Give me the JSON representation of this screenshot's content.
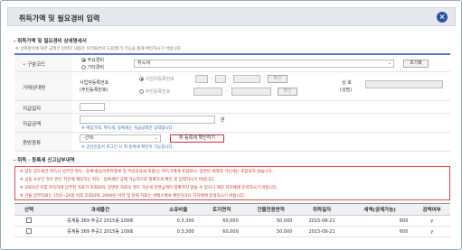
{
  "dialog": {
    "title": "취득가액 및 필요경비 입력",
    "close_label": "×"
  },
  "detail_section": {
    "heading": "- 취득가액 및 필요경비 상세명세서",
    "note": "※ 선택항목에 대한 금액은 입력된 내용은 이전화면의 도움말[?] 기능을 통해 확인하시기 바랍니다.",
    "category": {
      "label": "구분코드",
      "options": [
        "주요경비",
        "기타경비"
      ],
      "selected": "주요경비",
      "select_value": "취득세",
      "reset_label": "초기화"
    },
    "counterpart": {
      "label": "거래상대방",
      "sub_label_1": "사업자등록번호",
      "sub_label_2": "(주민등록번호)",
      "biz_option": "사업자등록번호",
      "resident_option": "주민등록번호",
      "confirm_label": "확인",
      "confirm_label_2": "확인",
      "trade_name_label_1": "상 호",
      "trade_name_label_2": "(성명)"
    },
    "pay_date": {
      "label": "지급일자"
    },
    "pay_amount": {
      "label": "지급금액",
      "unit": "원",
      "hint": "※ 매입가액, 취득세, 등록세는 지급금액만 입력합니다."
    },
    "evidence": {
      "label": "증빙종류",
      "select_value": "-선택-",
      "check_button": "취·등록세 확인하기",
      "hint": "※ 공인인증서 로그인 시 취·등록세 확인이 가능합니다."
    }
  },
  "tax_section": {
    "heading": "- 취득 · 등록세 신고납부내역",
    "notices": [
      "※ 양도 양도물건 취득시 납부한 취득 · 등록세(농어촌특별세 및 지방교육세 포함)는 취득가액에 포함되나, 감면된 세액과 가산세는 포함되지 않습니다.",
      "※ 공동 소유인 경우 본인 지분에 해당하는 취득 · 등록세만 공제 가능하므로 정확하게 확인 후 입력하시기 바랍니다.",
      "※ 2001년 이후 취득하여 납부된 자료가 조회되며, 감면된 자료의 경우 가산세 감면금액이 정확하지 않을 수 있으니 해당 지자체에 문의하시기 바랍니다.",
      "※ 건물 납부자료는 15일~20일 이후 조회되며, 2000년 이전 및 현재 자료는 위택스에서 확인하거나 지자체에 문의하시기 바랍니다."
    ],
    "table": {
      "headers": [
        "선택",
        "과세물건",
        "소유비율",
        "토지면적",
        "건물전용면적",
        "취득일자",
        "세액(공제가능)",
        "감액여부"
      ],
      "rows": [
        [
          "",
          "중계동 369 주공2 2015동 109호",
          "0.3,300",
          "60,000",
          "50,000",
          "2015-09-21",
          "600",
          "y"
        ],
        [
          "",
          "중계동 369 주공2 2015동 109호",
          "0.3,300",
          "60,000",
          "50,000",
          "2015-09-21",
          "600",
          "y"
        ]
      ]
    }
  }
}
